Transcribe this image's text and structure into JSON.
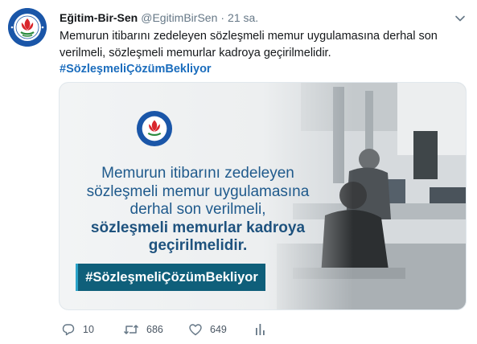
{
  "tweet": {
    "author_name": "Eğitim-Bir-Sen",
    "author_handle": "@EgitimBirSen",
    "separator": "·",
    "time": "21 sa.",
    "text": "Memurun itibarını zedeleyen sözleşmeli memur uygulamasına derhal son verilmeli, sözleşmeli memurlar kadroya geçirilmelidir.",
    "hashtag": "#SözleşmeliÇözümBekliyor"
  },
  "avatar": {
    "logo_text": "EĞİTİM-BİR-SEN",
    "color": "#1a56a8"
  },
  "media": {
    "logo_text": "EĞİTİM-BİR-SEN",
    "lines": [
      "Memurun itibarını zedeleyen",
      "sözleşmeli memur uygulamasına",
      "derhal son verilmeli,"
    ],
    "bold_lines": [
      "sözleşmeli memurlar kadroya",
      "geçirilmelidir."
    ],
    "banner": "#SözleşmeliÇözümBekliyor",
    "text_color": "#1f5a8c",
    "banner_color": "#0f5f7a"
  },
  "actions": {
    "reply": {
      "icon": "reply-icon",
      "count": "10"
    },
    "retweet": {
      "icon": "retweet-icon",
      "count": "686"
    },
    "like": {
      "icon": "heart-icon",
      "count": "649"
    },
    "analytics": {
      "icon": "analytics-icon"
    }
  },
  "colors": {
    "link": "#1b6dbd",
    "secondary_text": "#657786"
  }
}
